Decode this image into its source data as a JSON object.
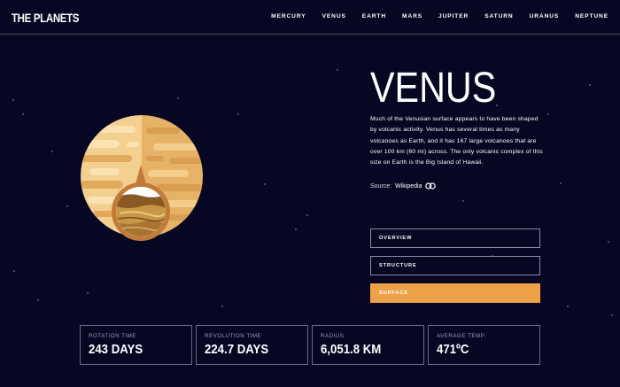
{
  "header": {
    "logo": "THE PLANETS",
    "nav": [
      "MERCURY",
      "VENUS",
      "EARTH",
      "MARS",
      "JUPITER",
      "SATURN",
      "URANUS",
      "NEPTUNE"
    ]
  },
  "planet": {
    "name": "VENUS",
    "description": "Much of the Venusian surface appears to have been shaped by volcanic activity. Venus has several times as many volcanoes as Earth, and it has 167 large volcanoes that are over 100 km (60 mi) across. The only volcanic complex of this size on Earth is the Big Island of Hawaii.",
    "source_prefix": "Source:",
    "source_link": "Wikipedia",
    "link_icon": "link-icon"
  },
  "tabs": {
    "overview": "OVERVIEW",
    "structure": "STRUCTURE",
    "surface": "SURFACE",
    "active": "surface"
  },
  "stats": [
    {
      "label": "ROTATION TIME",
      "value": "243 DAYS"
    },
    {
      "label": "REVOLUTION TIME",
      "value": "224.7 DAYS"
    },
    {
      "label": "RADIUS",
      "value": "6,051.8 KM"
    },
    {
      "label": "AVERAGE TEMP.",
      "value": "471ºC"
    }
  ],
  "colors": {
    "background": "#070724",
    "accent": "#eda249",
    "border": "#8b8ba3",
    "planet_light": "#f5d79c",
    "planet_dark": "#e8b56a",
    "surface_ring": "#c27a3a"
  }
}
